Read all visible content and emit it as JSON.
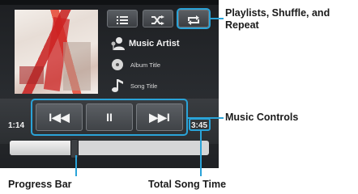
{
  "player": {
    "artist": "Music Artist",
    "album": "Album Title",
    "song": "Song Title",
    "elapsed": "1:14",
    "total": "3:45",
    "progress_fraction": 0.32
  },
  "top_buttons": [
    {
      "name": "playlists",
      "icon": "list-icon"
    },
    {
      "name": "shuffle",
      "icon": "shuffle-icon"
    },
    {
      "name": "repeat",
      "icon": "repeat-icon"
    }
  ],
  "controls": [
    {
      "name": "previous",
      "icon": "skip-previous-icon",
      "glyph": "I◀◀"
    },
    {
      "name": "pause",
      "icon": "pause-icon",
      "glyph": "II"
    },
    {
      "name": "next",
      "icon": "skip-next-icon",
      "glyph": "▶▶I"
    }
  ],
  "callouts": {
    "playlists": "Playlists, Shuffle, and Repeat",
    "controls": "Music Controls",
    "progress": "Progress Bar",
    "total": "Total Song Time"
  },
  "colors": {
    "callout": "#2aa3d8",
    "button": "#4a4e53",
    "background": "#2a2d31"
  }
}
